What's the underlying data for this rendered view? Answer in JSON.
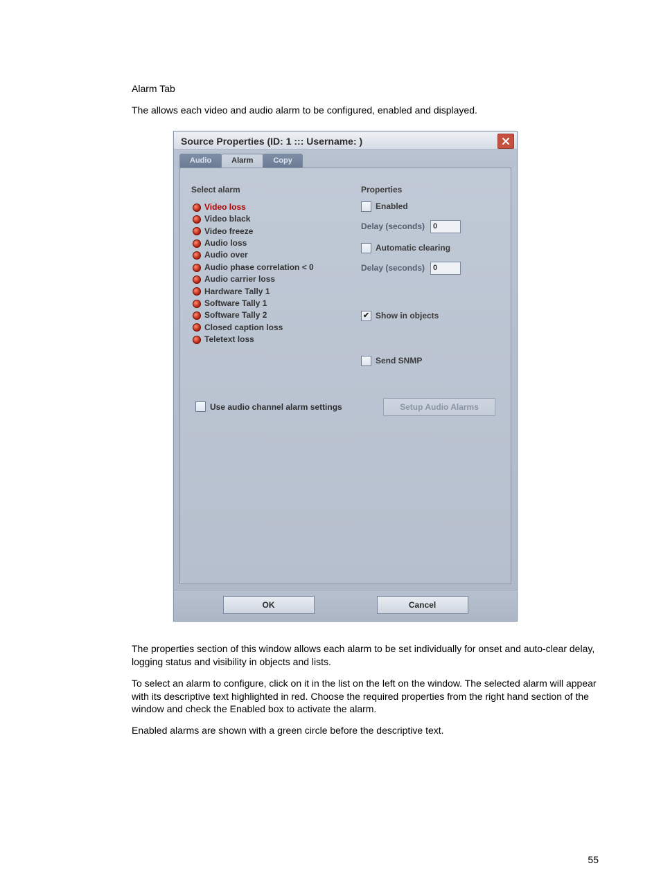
{
  "doc": {
    "heading": "Alarm Tab",
    "p1_a": "The ",
    "p1_b": " allows each video and audio alarm to be configured, enabled and displayed.",
    "p2": "The properties section of this window allows each alarm to be set individually for onset and auto-clear delay, logging status and visibility in objects and lists.",
    "p3_a": "To select an alarm to configure, click on it in the ",
    "p3_b": " list on the left on the window. The selected alarm will appear with its descriptive text highlighted in red. Choose the required properties from the right hand section of the window and check the Enabled box to activate the alarm.",
    "p4": "Enabled alarms are shown with a green circle before the descriptive text.",
    "page_number": "55"
  },
  "dialog": {
    "title": "Source Properties  (ID: 1 ::: Username:  )",
    "tabs": [
      "Audio",
      "Alarm",
      "Copy"
    ],
    "active_tab": 1,
    "left_heading": "Select alarm",
    "right_heading": "Properties",
    "alarms": [
      "Video loss",
      "Video black",
      "Video freeze",
      "Audio loss",
      "Audio over",
      "Audio phase correlation < 0",
      "Audio carrier loss",
      "Hardware Tally 1",
      "Software Tally 1",
      "Software Tally 2",
      "Closed caption loss",
      "Teletext loss"
    ],
    "selected_alarm": 0,
    "checks": {
      "enabled": "Enabled",
      "auto_clear": "Automatic clearing",
      "show_objects": "Show in objects",
      "send_snmp": "Send SNMP",
      "use_audio": "Use audio channel alarm settings"
    },
    "delay_label": "Delay (seconds)",
    "delay1": "0",
    "delay2": "0",
    "setup_audio_btn": "Setup Audio Alarms",
    "ok": "OK",
    "cancel": "Cancel"
  }
}
